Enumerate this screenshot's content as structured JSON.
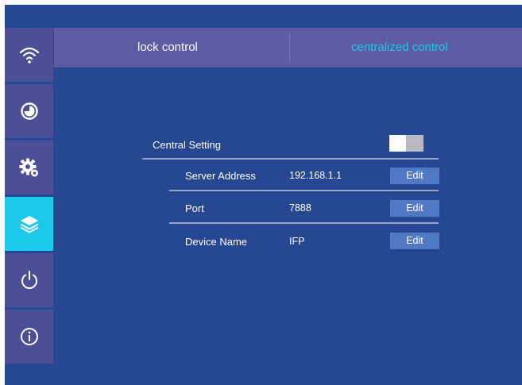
{
  "sidebar": {
    "items": [
      {
        "icon": "wifi-icon",
        "active": false
      },
      {
        "icon": "clock-icon",
        "active": false
      },
      {
        "icon": "gear-icon",
        "active": false
      },
      {
        "icon": "layers-icon",
        "active": true
      },
      {
        "icon": "power-icon",
        "active": false
      },
      {
        "icon": "info-icon",
        "active": false
      }
    ]
  },
  "tabs": {
    "lock_control": "lock control",
    "centralized_control": "centralized control"
  },
  "central_setting": {
    "label": "Central Setting",
    "enabled": false
  },
  "rows": [
    {
      "label": "Server Address",
      "value": "192.168.1.1",
      "button": "Edit"
    },
    {
      "label": "Port",
      "value": "7888",
      "button": "Edit"
    },
    {
      "label": "Device Name",
      "value": "IFP",
      "button": "Edit"
    }
  ],
  "colors": {
    "background": "#264791",
    "sidebar_item": "#4c4f95",
    "active": "#1cc9ea",
    "tabbar": "#5d5ba3",
    "edit_button": "#5179c3"
  }
}
